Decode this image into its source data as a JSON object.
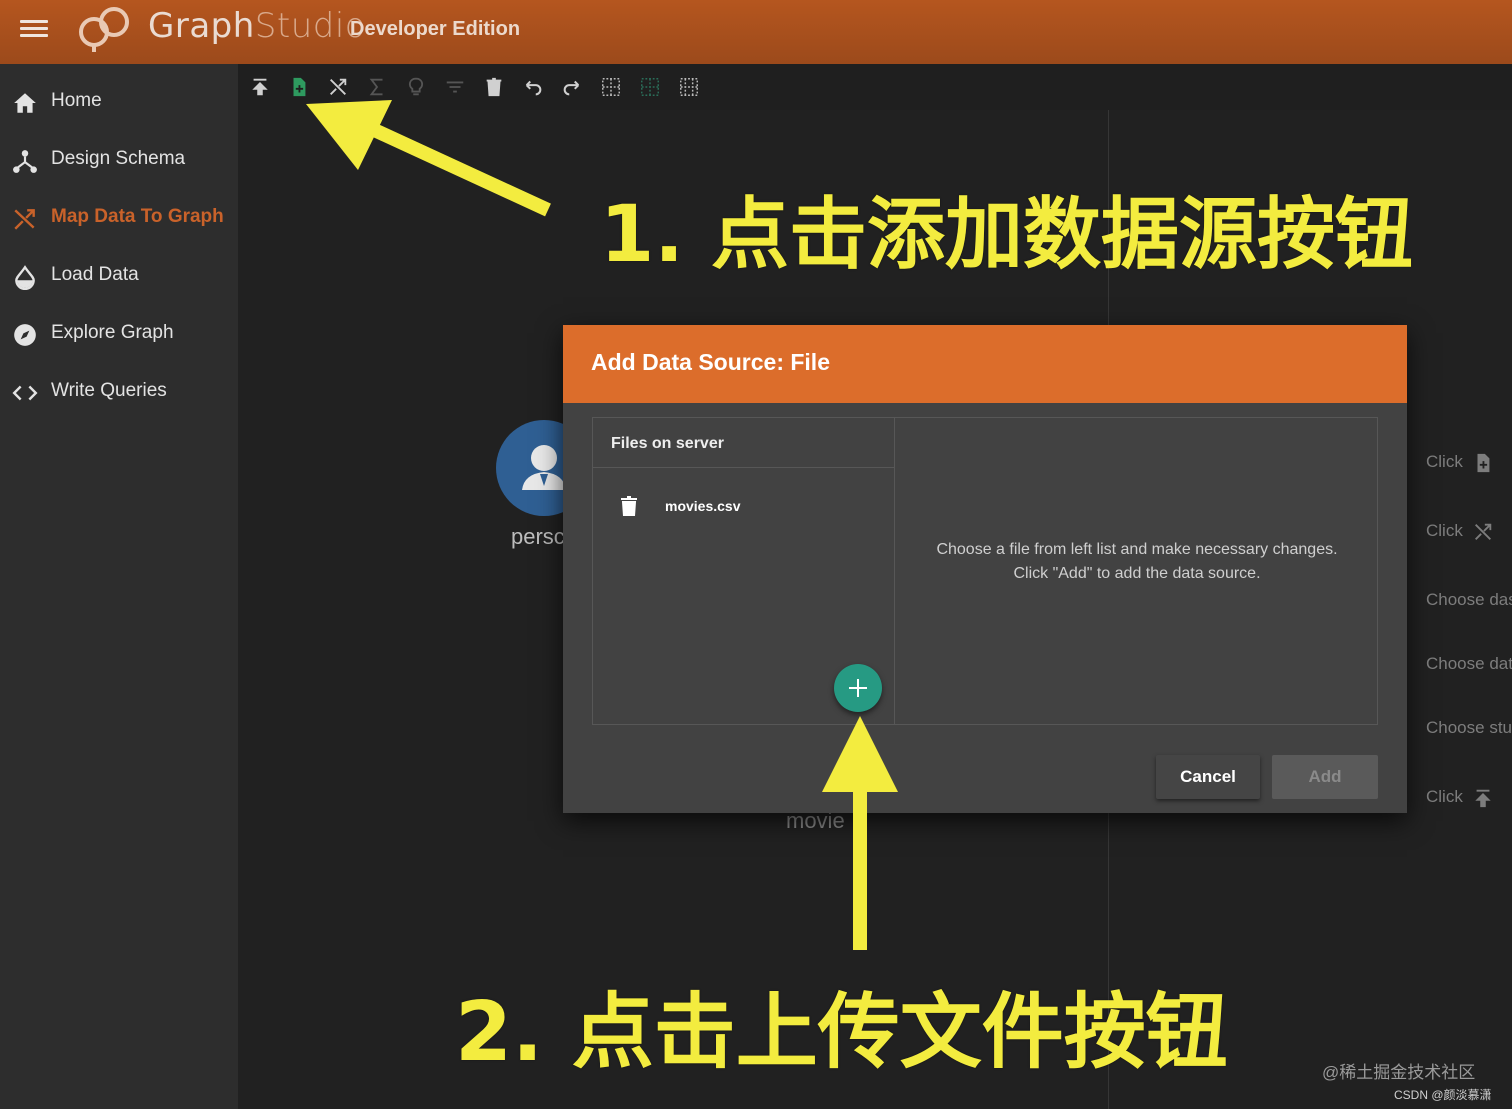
{
  "app": {
    "brand_graph": "Graph",
    "brand_studio": "Studio",
    "edition": "Developer Edition",
    "accent_color": "#dc6d2b"
  },
  "sidebar": {
    "items": [
      {
        "label": "Home",
        "icon": "home-icon",
        "active": false
      },
      {
        "label": "Design Schema",
        "icon": "schema-icon",
        "active": false
      },
      {
        "label": "Map Data To Graph",
        "icon": "shuffle-icon",
        "active": true
      },
      {
        "label": "Load Data",
        "icon": "droplet-icon",
        "active": false
      },
      {
        "label": "Explore Graph",
        "icon": "compass-icon",
        "active": false
      },
      {
        "label": "Write Queries",
        "icon": "code-icon",
        "active": false
      }
    ]
  },
  "toolbar": {
    "icons": [
      "publish-icon",
      "add-data-file-icon",
      "map-icon",
      "sigma-icon",
      "bulb-icon",
      "filter-icon",
      "delete-icon",
      "undo-icon",
      "redo-icon",
      "grid-icon",
      "grid-highlight-icon",
      "grid-alt-icon"
    ]
  },
  "graph": {
    "person_label": "persc",
    "movie_label": "movie"
  },
  "hints": [
    {
      "text": "Click",
      "icon": "add-file-icon"
    },
    {
      "text": "Click",
      "icon": "shuffle-icon"
    },
    {
      "text": "Choose das"
    },
    {
      "text": "Choose dat"
    },
    {
      "text": "Choose stu"
    },
    {
      "text": "Click",
      "icon": "publish-icon"
    }
  ],
  "dialog": {
    "title": "Add Data Source: File",
    "files_header": "Files on server",
    "files": [
      "movies.csv"
    ],
    "instruction_line1": "Choose a file from left list and make necessary changes.",
    "instruction_line2": "Click \"Add\" to add the data source.",
    "cancel_label": "Cancel",
    "add_label": "Add"
  },
  "annotations": {
    "step1": "1. 点击添加数据源按钮",
    "step2": "2. 点击上传文件按钮",
    "color": "#f3ec3f"
  },
  "watermark": {
    "line1": "@稀土掘金技术社区",
    "line2": "CSDN @颜淡慕潇"
  }
}
